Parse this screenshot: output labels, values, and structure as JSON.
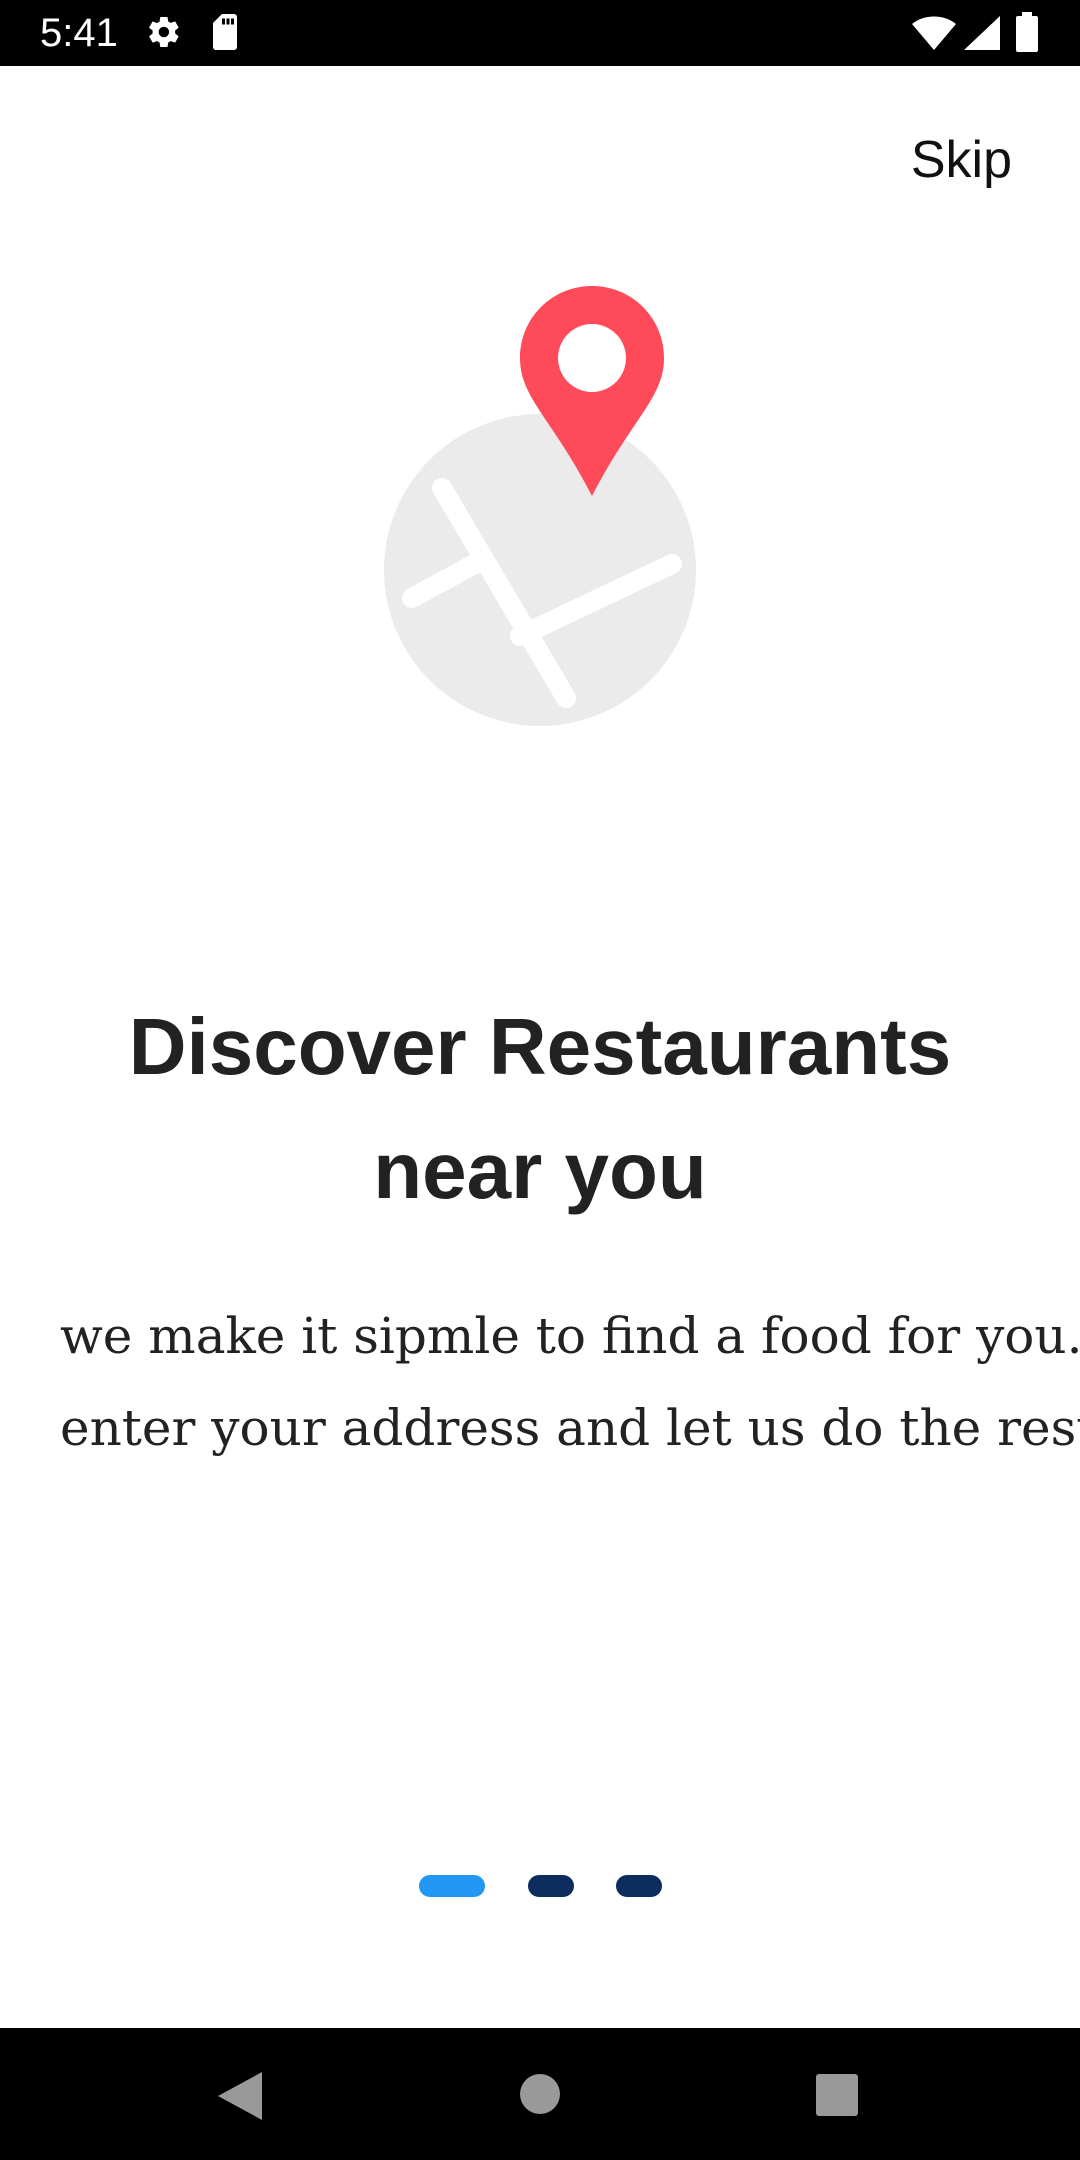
{
  "status_bar": {
    "time": "5:41",
    "left_icons": [
      "gear-icon",
      "sd-card-icon"
    ],
    "right_icons": [
      "wifi-icon",
      "signal-icon",
      "battery-icon"
    ]
  },
  "header": {
    "skip_label": "Skip"
  },
  "illustration": {
    "icon": "map-location-pin-icon",
    "pin_color": "#FF4A5A",
    "map_color": "#EBEBEB"
  },
  "onboarding": {
    "title_lines": [
      "Discover Restaurants",
      "near you"
    ],
    "subtitle_lines": [
      "we make it sipmle to find a food for you.",
      "enter your address and let us do the rest"
    ]
  },
  "page_indicator": {
    "count": 3,
    "active_index": 0,
    "active_color": "#2196F3",
    "inactive_color": "#0D2D5E"
  },
  "nav_bar": {
    "buttons": [
      "back-icon",
      "home-icon",
      "recents-icon"
    ]
  }
}
